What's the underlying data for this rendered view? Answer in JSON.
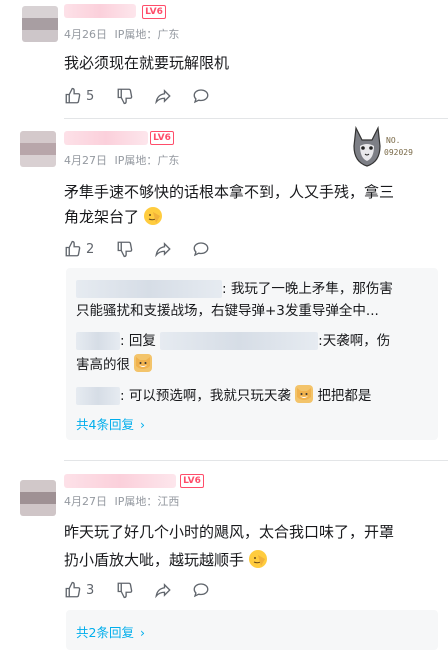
{
  "comments": [
    {
      "date": "4月26日",
      "ip": "IP属地：广东",
      "level": "LV6",
      "text": "我必须现在就要玩解限机",
      "likes": "5"
    },
    {
      "date": "4月27日",
      "ip": "IP属地：广东",
      "level": "LV6",
      "text_line1": "矛隼手速不够快的话根本拿不到，人又手残，拿三",
      "text_line2": "角龙架台了",
      "likes": "2",
      "badge_text": "NO.",
      "badge_number": "092029",
      "replies": [
        {
          "line1": ": 我玩了一晚上矛隼，那伤害",
          "line2": "只能骚扰和支援战场，右键导弹+3发重导弹全中..."
        },
        {
          "prefix": ": 回复 ",
          "line1_end": ":天袭啊，伤",
          "line2": "害高的很"
        },
        {
          "line1": ": 可以预选啊，我就只玩天袭",
          "line1_end": "把把都是"
        }
      ],
      "more_replies": "共4条回复"
    },
    {
      "date": "4月27日",
      "ip": "IP属地：江西",
      "level": "LV6",
      "text_line1": "昨天玩了好几个小时的飓风，太合我口味了，开罩",
      "text_line2": "扔小盾放大呲，越玩越顺手",
      "likes": "3",
      "more_replies": "共2条回复"
    }
  ],
  "icons": [
    "like-icon",
    "dislike-icon",
    "share-icon",
    "comment-icon",
    "chevron-right-icon"
  ]
}
